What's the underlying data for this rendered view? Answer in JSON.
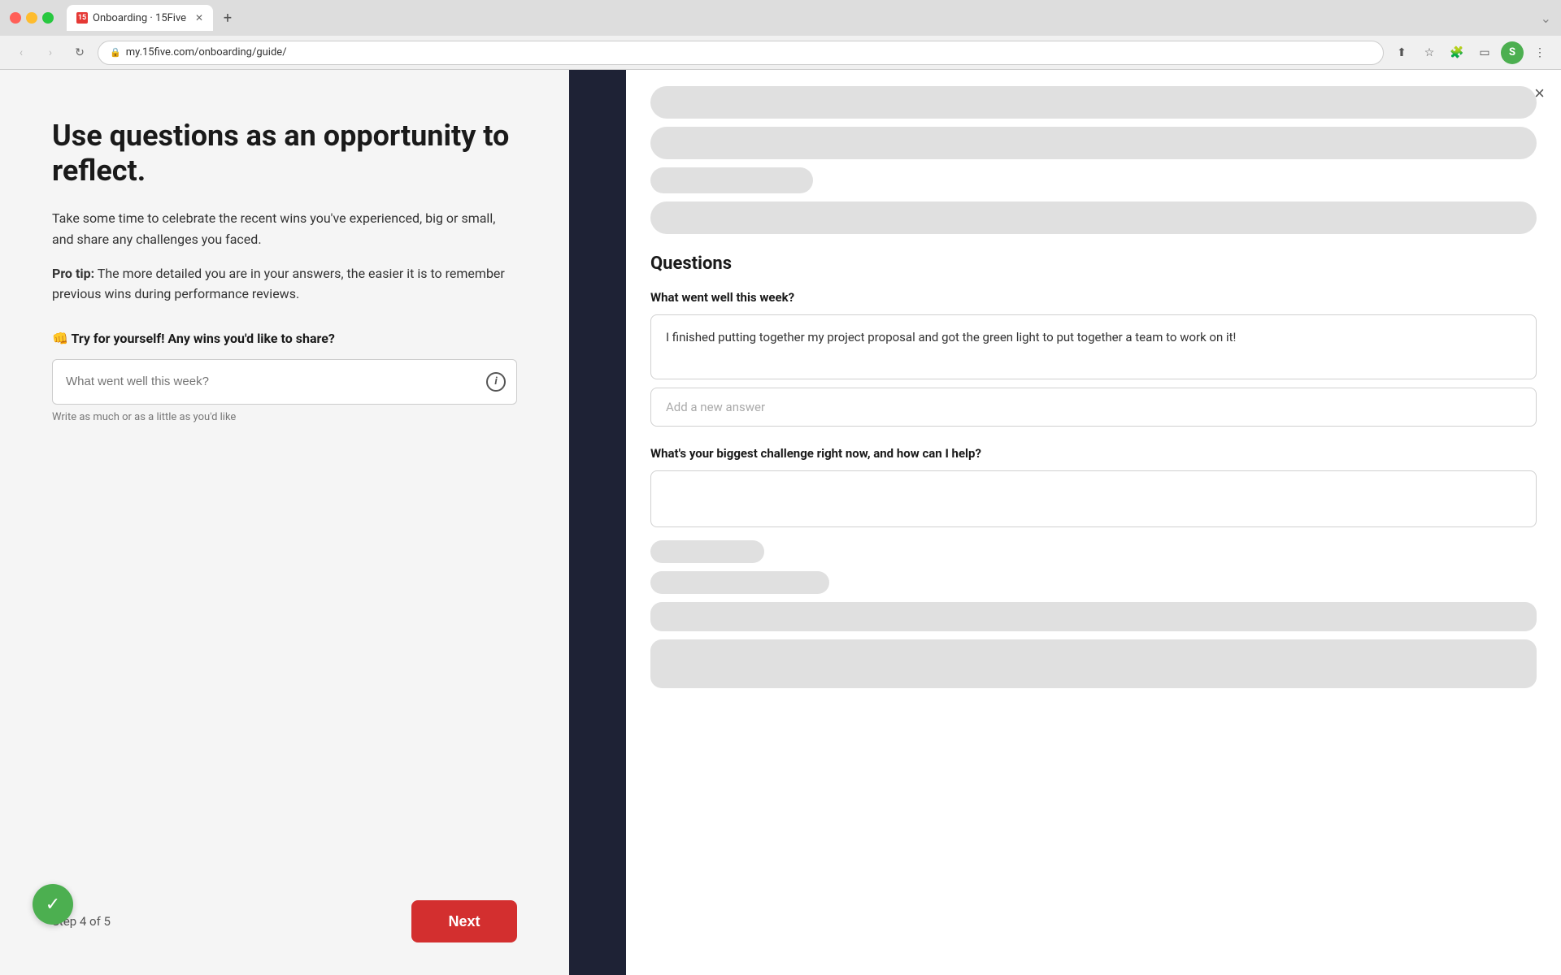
{
  "browser": {
    "tab_title": "Onboarding · 15Five",
    "tab_favicon_letter": "1",
    "url": "my.15five.com/onboarding/guide/",
    "new_tab_icon": "+",
    "back_icon": "‹",
    "forward_icon": "›",
    "refresh_icon": "↻",
    "profile_letter": "S"
  },
  "left_panel": {
    "title": "Use questions as an opportunity to reflect.",
    "description": "Take some time to celebrate the recent wins you've experienced, big or small, and share any challenges you faced.",
    "pro_tip_label": "Pro tip:",
    "pro_tip_text": " The more detailed you are in your answers, the easier it is to remember previous wins during performance reviews.",
    "try_label": "👊 Try for yourself! Any wins you'd like to share?",
    "input_placeholder": "What went well this week?",
    "input_hint": "Write as much or as a little as you'd like",
    "step_text": "Step 4 of 5",
    "next_button": "Next"
  },
  "right_panel": {
    "close_icon": "×",
    "questions_title": "Questions",
    "question1_label": "What went well this week?",
    "question1_answer": "I finished putting together my project proposal and got the green light to put together a team to work on it!",
    "add_answer_placeholder": "Add a new answer",
    "question2_label": "What's your biggest challenge right now, and how can I help?"
  }
}
